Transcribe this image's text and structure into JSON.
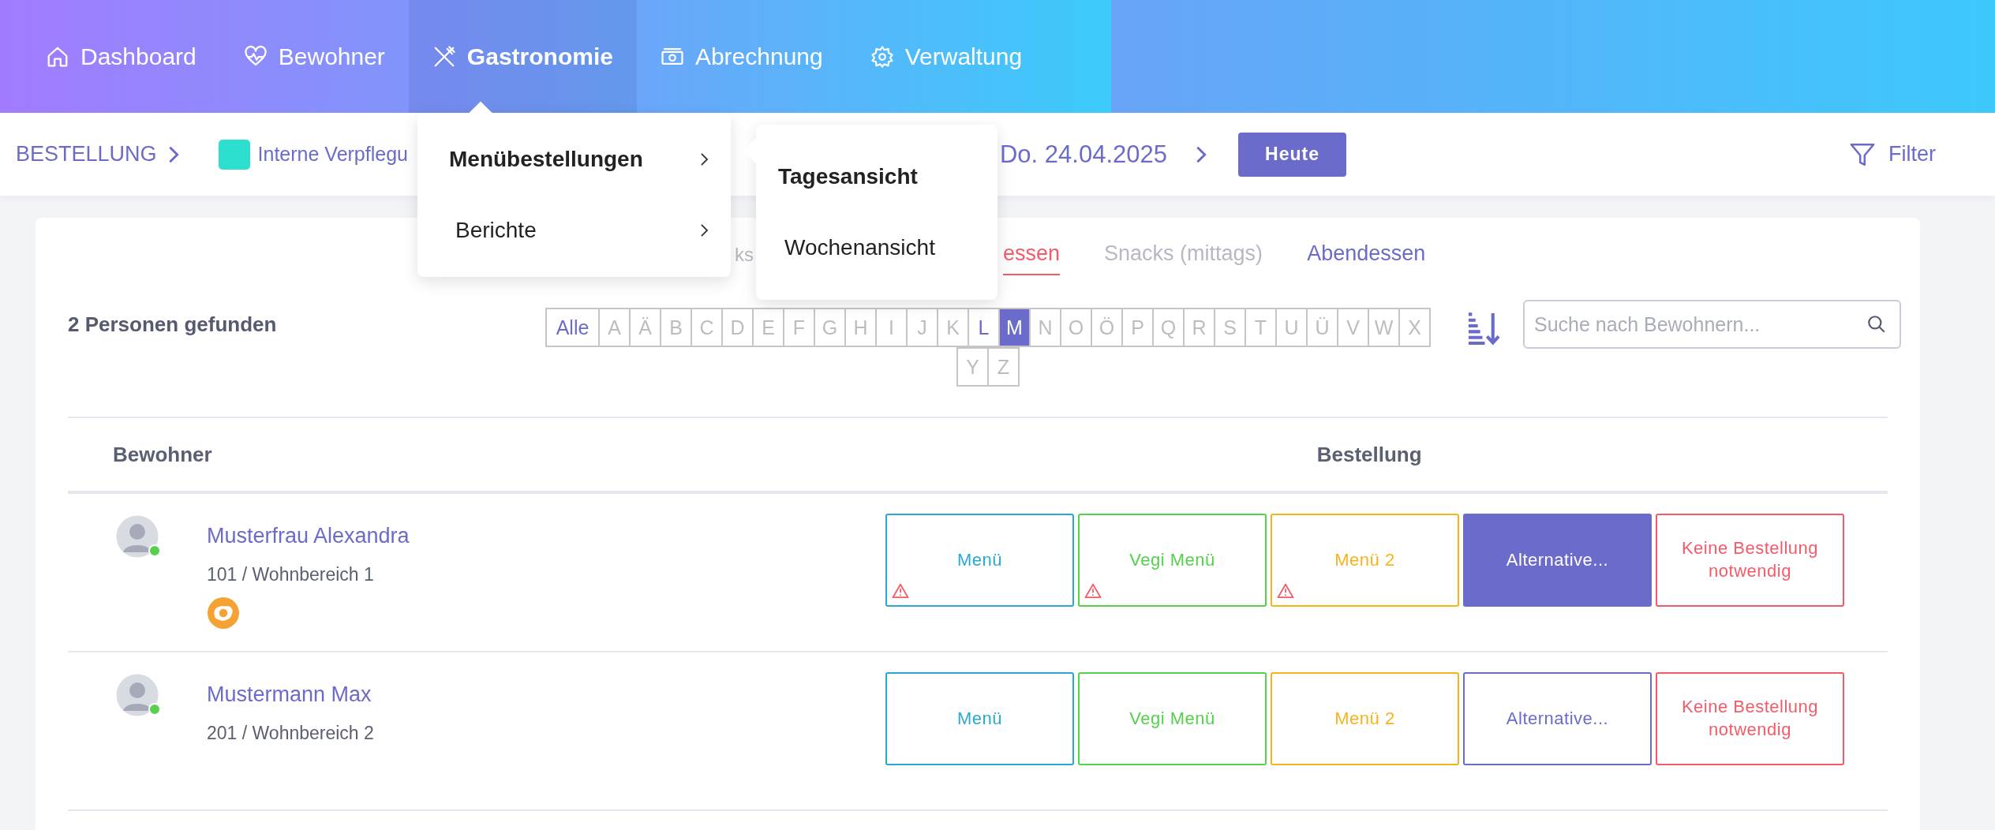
{
  "nav": {
    "items": [
      {
        "label": "Dashboard",
        "selected": false
      },
      {
        "label": "Bewohner",
        "selected": false
      },
      {
        "label": "Gastronomie",
        "selected": true
      },
      {
        "label": "Abrechnung",
        "selected": false
      },
      {
        "label": "Verwaltung",
        "selected": false
      }
    ]
  },
  "nav_menu": {
    "items": [
      {
        "label": "Menübestellungen",
        "selected": true
      },
      {
        "label": "Berichte",
        "selected": false
      }
    ],
    "submenu": {
      "items": [
        {
          "label": "Tagesansicht",
          "selected": true
        },
        {
          "label": "Wochenansicht",
          "selected": false
        }
      ]
    }
  },
  "breadcrumb": {
    "section": "BESTELLUNG",
    "unit": {
      "label": "Interne Verpflegu",
      "color": "#2ddfcf"
    }
  },
  "date": "Do. 24.04.2025",
  "today_button": "Heute",
  "filter_button": "Filter",
  "meal_tabs": [
    {
      "label": "ks",
      "selected": false,
      "disabled": true
    },
    {
      "label": "essen",
      "selected": true,
      "disabled": false
    },
    {
      "label": "Snacks (mittags)",
      "selected": false,
      "disabled": true
    },
    {
      "label": "Abendessen",
      "selected": false,
      "disabled": false
    }
  ],
  "result_count": "2 Personen gefunden",
  "letters": [
    {
      "label": "Alle",
      "selected": false,
      "available": true
    },
    {
      "label": "A",
      "selected": false,
      "available": false
    },
    {
      "label": "Ä",
      "selected": false,
      "available": false
    },
    {
      "label": "B",
      "selected": false,
      "available": false
    },
    {
      "label": "C",
      "selected": false,
      "available": false
    },
    {
      "label": "D",
      "selected": false,
      "available": false
    },
    {
      "label": "E",
      "selected": false,
      "available": false
    },
    {
      "label": "F",
      "selected": false,
      "available": false
    },
    {
      "label": "G",
      "selected": false,
      "available": false
    },
    {
      "label": "H",
      "selected": false,
      "available": false
    },
    {
      "label": "I",
      "selected": false,
      "available": false
    },
    {
      "label": "J",
      "selected": false,
      "available": false
    },
    {
      "label": "K",
      "selected": false,
      "available": false
    },
    {
      "label": "L",
      "selected": false,
      "available": true
    },
    {
      "label": "M",
      "selected": true,
      "available": true
    },
    {
      "label": "N",
      "selected": false,
      "available": false
    },
    {
      "label": "O",
      "selected": false,
      "available": false
    },
    {
      "label": "Ö",
      "selected": false,
      "available": false
    },
    {
      "label": "P",
      "selected": false,
      "available": false
    },
    {
      "label": "Q",
      "selected": false,
      "available": false
    },
    {
      "label": "R",
      "selected": false,
      "available": false
    },
    {
      "label": "S",
      "selected": false,
      "available": false
    },
    {
      "label": "T",
      "selected": false,
      "available": false
    },
    {
      "label": "U",
      "selected": false,
      "available": false
    },
    {
      "label": "Ü",
      "selected": false,
      "available": false
    },
    {
      "label": "V",
      "selected": false,
      "available": false
    },
    {
      "label": "W",
      "selected": false,
      "available": false
    },
    {
      "label": "X",
      "selected": false,
      "available": false
    },
    {
      "label": "Y",
      "selected": false,
      "available": false
    },
    {
      "label": "Z",
      "selected": false,
      "available": false
    }
  ],
  "search": {
    "placeholder": "Suche nach Bewohnern..."
  },
  "table": {
    "columns": [
      "Bewohner",
      "Bestellung"
    ],
    "rows": [
      {
        "name": "Musterfrau Alexandra",
        "location": "101 / Wohnbereich 1",
        "online": true,
        "diet_badge": true,
        "orders": [
          {
            "label": "Menü",
            "color": "#29a9d0",
            "selected": false,
            "warning": true
          },
          {
            "label": "Vegi Menü",
            "color": "#52d14a",
            "selected": false,
            "warning": true
          },
          {
            "label": "Menü 2",
            "color": "#f9b31a",
            "selected": false,
            "warning": true
          },
          {
            "label": "Alternative...",
            "color": "#6b6bcc",
            "selected": true,
            "warning": false
          },
          {
            "label": "Keine Bestellung notwendig",
            "color": "#f45b69",
            "selected": false,
            "warning": false
          }
        ]
      },
      {
        "name": "Mustermann Max",
        "location": "201 / Wohnbereich 2",
        "online": true,
        "diet_badge": false,
        "orders": [
          {
            "label": "Menü",
            "color": "#29a9d0",
            "selected": false,
            "warning": false
          },
          {
            "label": "Vegi Menü",
            "color": "#52d14a",
            "selected": false,
            "warning": false
          },
          {
            "label": "Menü 2",
            "color": "#f9b31a",
            "selected": false,
            "warning": false
          },
          {
            "label": "Alternative...",
            "color": "#6b6bcc",
            "selected": false,
            "warning": false
          },
          {
            "label": "Keine Bestellung notwendig",
            "color": "#f45b69",
            "selected": false,
            "warning": false
          }
        ]
      }
    ]
  }
}
